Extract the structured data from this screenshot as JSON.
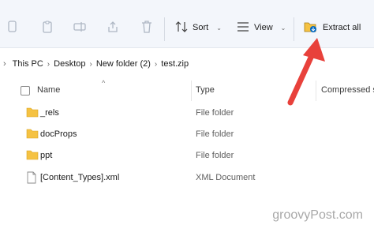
{
  "toolbar": {
    "sort_label": "Sort",
    "view_label": "View",
    "extract_label": "Extract all"
  },
  "breadcrumb": {
    "items": [
      "This PC",
      "Desktop",
      "New folder (2)",
      "test.zip"
    ]
  },
  "columns": {
    "name": "Name",
    "type": "Type",
    "compressed": "Compressed s"
  },
  "files": [
    {
      "name": "_rels",
      "type": "File folder",
      "icon": "folder-icon"
    },
    {
      "name": "docProps",
      "type": "File folder",
      "icon": "folder-icon"
    },
    {
      "name": "ppt",
      "type": "File folder",
      "icon": "folder-icon"
    },
    {
      "name": "[Content_Types].xml",
      "type": "XML Document",
      "icon": "file-icon"
    }
  ],
  "watermark": "groovyPost.com",
  "colors": {
    "accent": "#0067c0",
    "arrow": "#e8413b",
    "folder": "#f5c242"
  }
}
